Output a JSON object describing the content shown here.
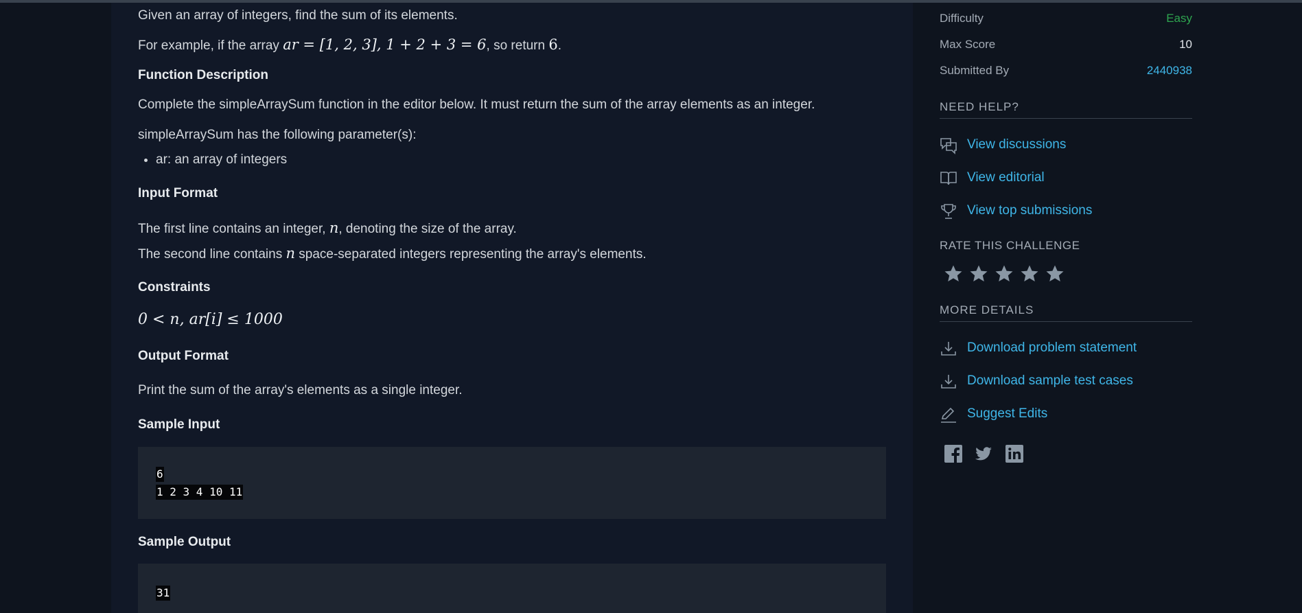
{
  "problem": {
    "intro": "Given an array of integers, find the sum of its elements.",
    "example_prefix": "For example, if the array ",
    "example_math1": "ar = [1, 2, 3], 1 + 2 + 3 = 6",
    "example_mid": ", so return ",
    "example_math2": "6",
    "example_suffix": ".",
    "function_description_heading": "Function Description",
    "function_description": "Complete the simpleArraySum function in the editor below. It must return the sum of the array elements as an integer.",
    "params_intro": "simpleArraySum has the following parameter(s):",
    "params": [
      "ar: an array of integers"
    ],
    "input_format_heading": "Input Format",
    "input_line1_prefix": "The first line contains an integer, ",
    "input_line1_var": "n",
    "input_line1_suffix": ", denoting the size of the array.",
    "input_line2_prefix": "The second line contains ",
    "input_line2_var": "n",
    "input_line2_suffix": " space-separated integers representing the array's elements.",
    "constraints_heading": "Constraints",
    "constraints_math": "0 < n, ar[i] ≤ 1000",
    "output_format_heading": "Output Format",
    "output_format": "Print the sum of the array's elements as a single integer.",
    "sample_input_heading": "Sample Input",
    "sample_input_lines": [
      "6",
      "1 2 3 4 10 11"
    ],
    "sample_output_heading": "Sample Output",
    "sample_output_lines": [
      "31"
    ]
  },
  "sidebar": {
    "difficulty_label": "Difficulty",
    "difficulty_value": "Easy",
    "max_score_label": "Max Score",
    "max_score_value": "10",
    "submitted_by_label": "Submitted By",
    "submitted_by_value": "2440938",
    "need_help_title": "NEED HELP?",
    "help_links": [
      {
        "label": "View discussions",
        "icon": "discussion-icon"
      },
      {
        "label": "View editorial",
        "icon": "book-icon"
      },
      {
        "label": "View top submissions",
        "icon": "trophy-icon"
      }
    ],
    "rate_title": "RATE THIS CHALLENGE",
    "rating": {
      "filled": 0,
      "max": 5
    },
    "more_details_title": "MORE DETAILS",
    "detail_links": [
      {
        "label": "Download problem statement",
        "icon": "download-icon"
      },
      {
        "label": "Download sample test cases",
        "icon": "download-icon"
      },
      {
        "label": "Suggest Edits",
        "icon": "edit-icon"
      }
    ],
    "social_icons": [
      "facebook-icon",
      "twitter-icon",
      "linkedin-icon"
    ]
  },
  "colors": {
    "background": "#0e141e",
    "panel": "#111827",
    "code_background": "#1e2530",
    "link": "#3fb6e8",
    "easy": "#2ea44f",
    "muted": "#a3abb5",
    "star": "#8a97a4"
  }
}
